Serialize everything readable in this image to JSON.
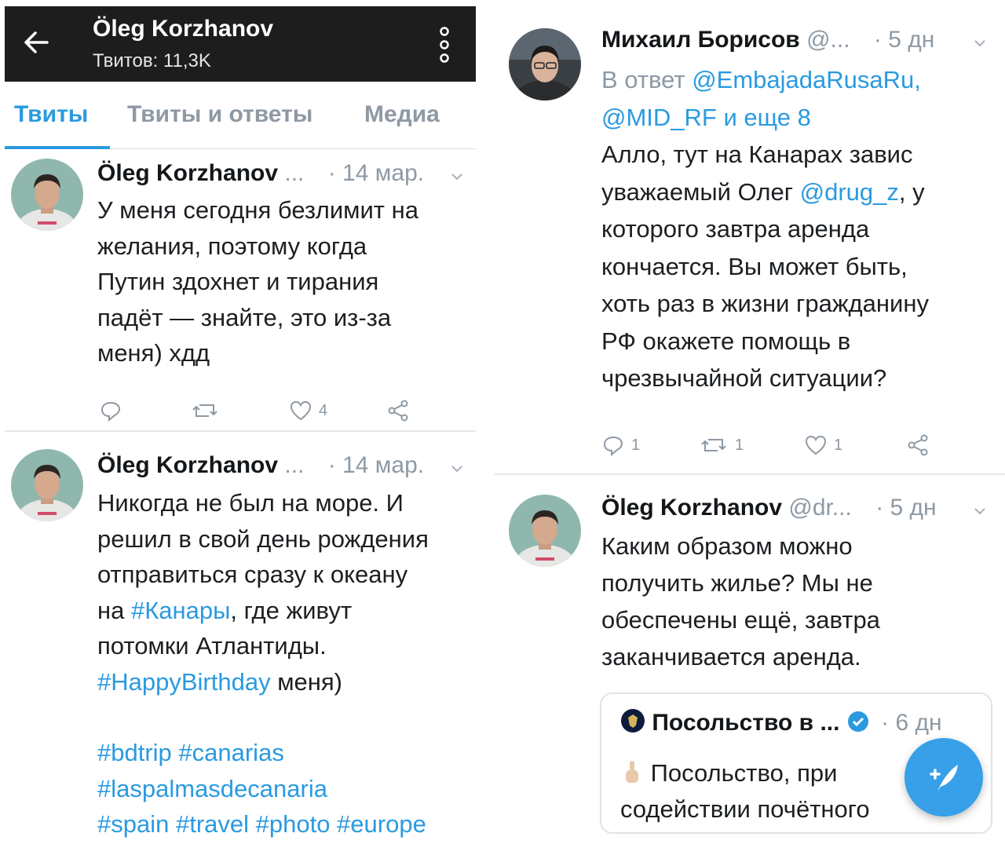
{
  "left": {
    "topbar": {
      "profile_name": "Öleg Korzhanov",
      "tweet_count": "Твитов: 11,3K"
    },
    "tabs": [
      {
        "label": "Твиты"
      },
      {
        "label": "Твиты и ответы"
      },
      {
        "label": "Медиа"
      }
    ],
    "tweets": [
      {
        "author": "Öleg Korzhanov",
        "handle": "...",
        "time": "· 14 мар.",
        "lines": [
          "У меня сегодня безлимит на",
          "желания, поэтому когда",
          "Путин здохнет и тирания",
          "падёт — знайте, это из-за",
          "меня) хдд"
        ],
        "likes": "4"
      },
      {
        "author": "Öleg Korzhanov",
        "handle": "...",
        "time": "· 14 мар.",
        "line1": "Никогда не был на море. И",
        "line2": "решил в свой день рождения",
        "line3": "отправиться сразу к океану",
        "line4_pre": "на ",
        "line4_tag": "#Канары",
        "line4_post": ", где живут",
        "line5": "потомки Атлантиды.",
        "line6_tag": "#HappyBirthday",
        "line6_post": " меня)",
        "hashtags_line1": "#bdtrip #canarias",
        "hashtags_line2": "#laspalmasdecanaria",
        "hashtags_line3": "#spain #travel #photo #europe"
      }
    ]
  },
  "right": {
    "reply_tweet": {
      "author": "Михаил Борисов",
      "handle": "@...",
      "time": "· 5 дн",
      "reply_prefix": "В ответ ",
      "reply_to_1": "@EmbajadaRusaRu,",
      "reply_to_2": "@MID_RF",
      "reply_more": " и еще 8",
      "line1": "Алло, тут на Канарах завис",
      "line2_pre": "уважаемый Олег ",
      "line2_mention": "@drug_z",
      "line2_post": ", у",
      "line3": "которого завтра аренда",
      "line4": "кончается. Вы может быть,",
      "line5": "хоть раз в жизни гражданину",
      "line6": "РФ окажете помощь в",
      "line7": "чрезвычайной ситуации?",
      "replies": "1",
      "retweets": "1",
      "likes": "1"
    },
    "oleg_tweet": {
      "author": "Öleg Korzhanov",
      "handle": "@dr...",
      "time": "· 5 дн",
      "lines": [
        "Каким образом можно",
        "получить жилье? Мы не",
        "обеспечены ещё, завтра",
        "заканчивается аренда."
      ]
    },
    "quote": {
      "author": "Посольство в ...",
      "time": "· 6 дн",
      "line1": "Посольство, при",
      "line2": "содействии почётного"
    }
  },
  "colors": {
    "accent": "#2a9ae0",
    "topbar_bg": "#1d1d1d",
    "muted": "#8e99a4",
    "fab": "#37a0e8"
  },
  "icons": [
    "back-arrow-icon",
    "kebab-menu-icon",
    "reply-icon",
    "retweet-icon",
    "like-icon",
    "share-icon",
    "chevron-down-icon",
    "verified-icon",
    "embassy-emblem-icon",
    "pointing-hand-icon",
    "compose-tweet-icon"
  ]
}
